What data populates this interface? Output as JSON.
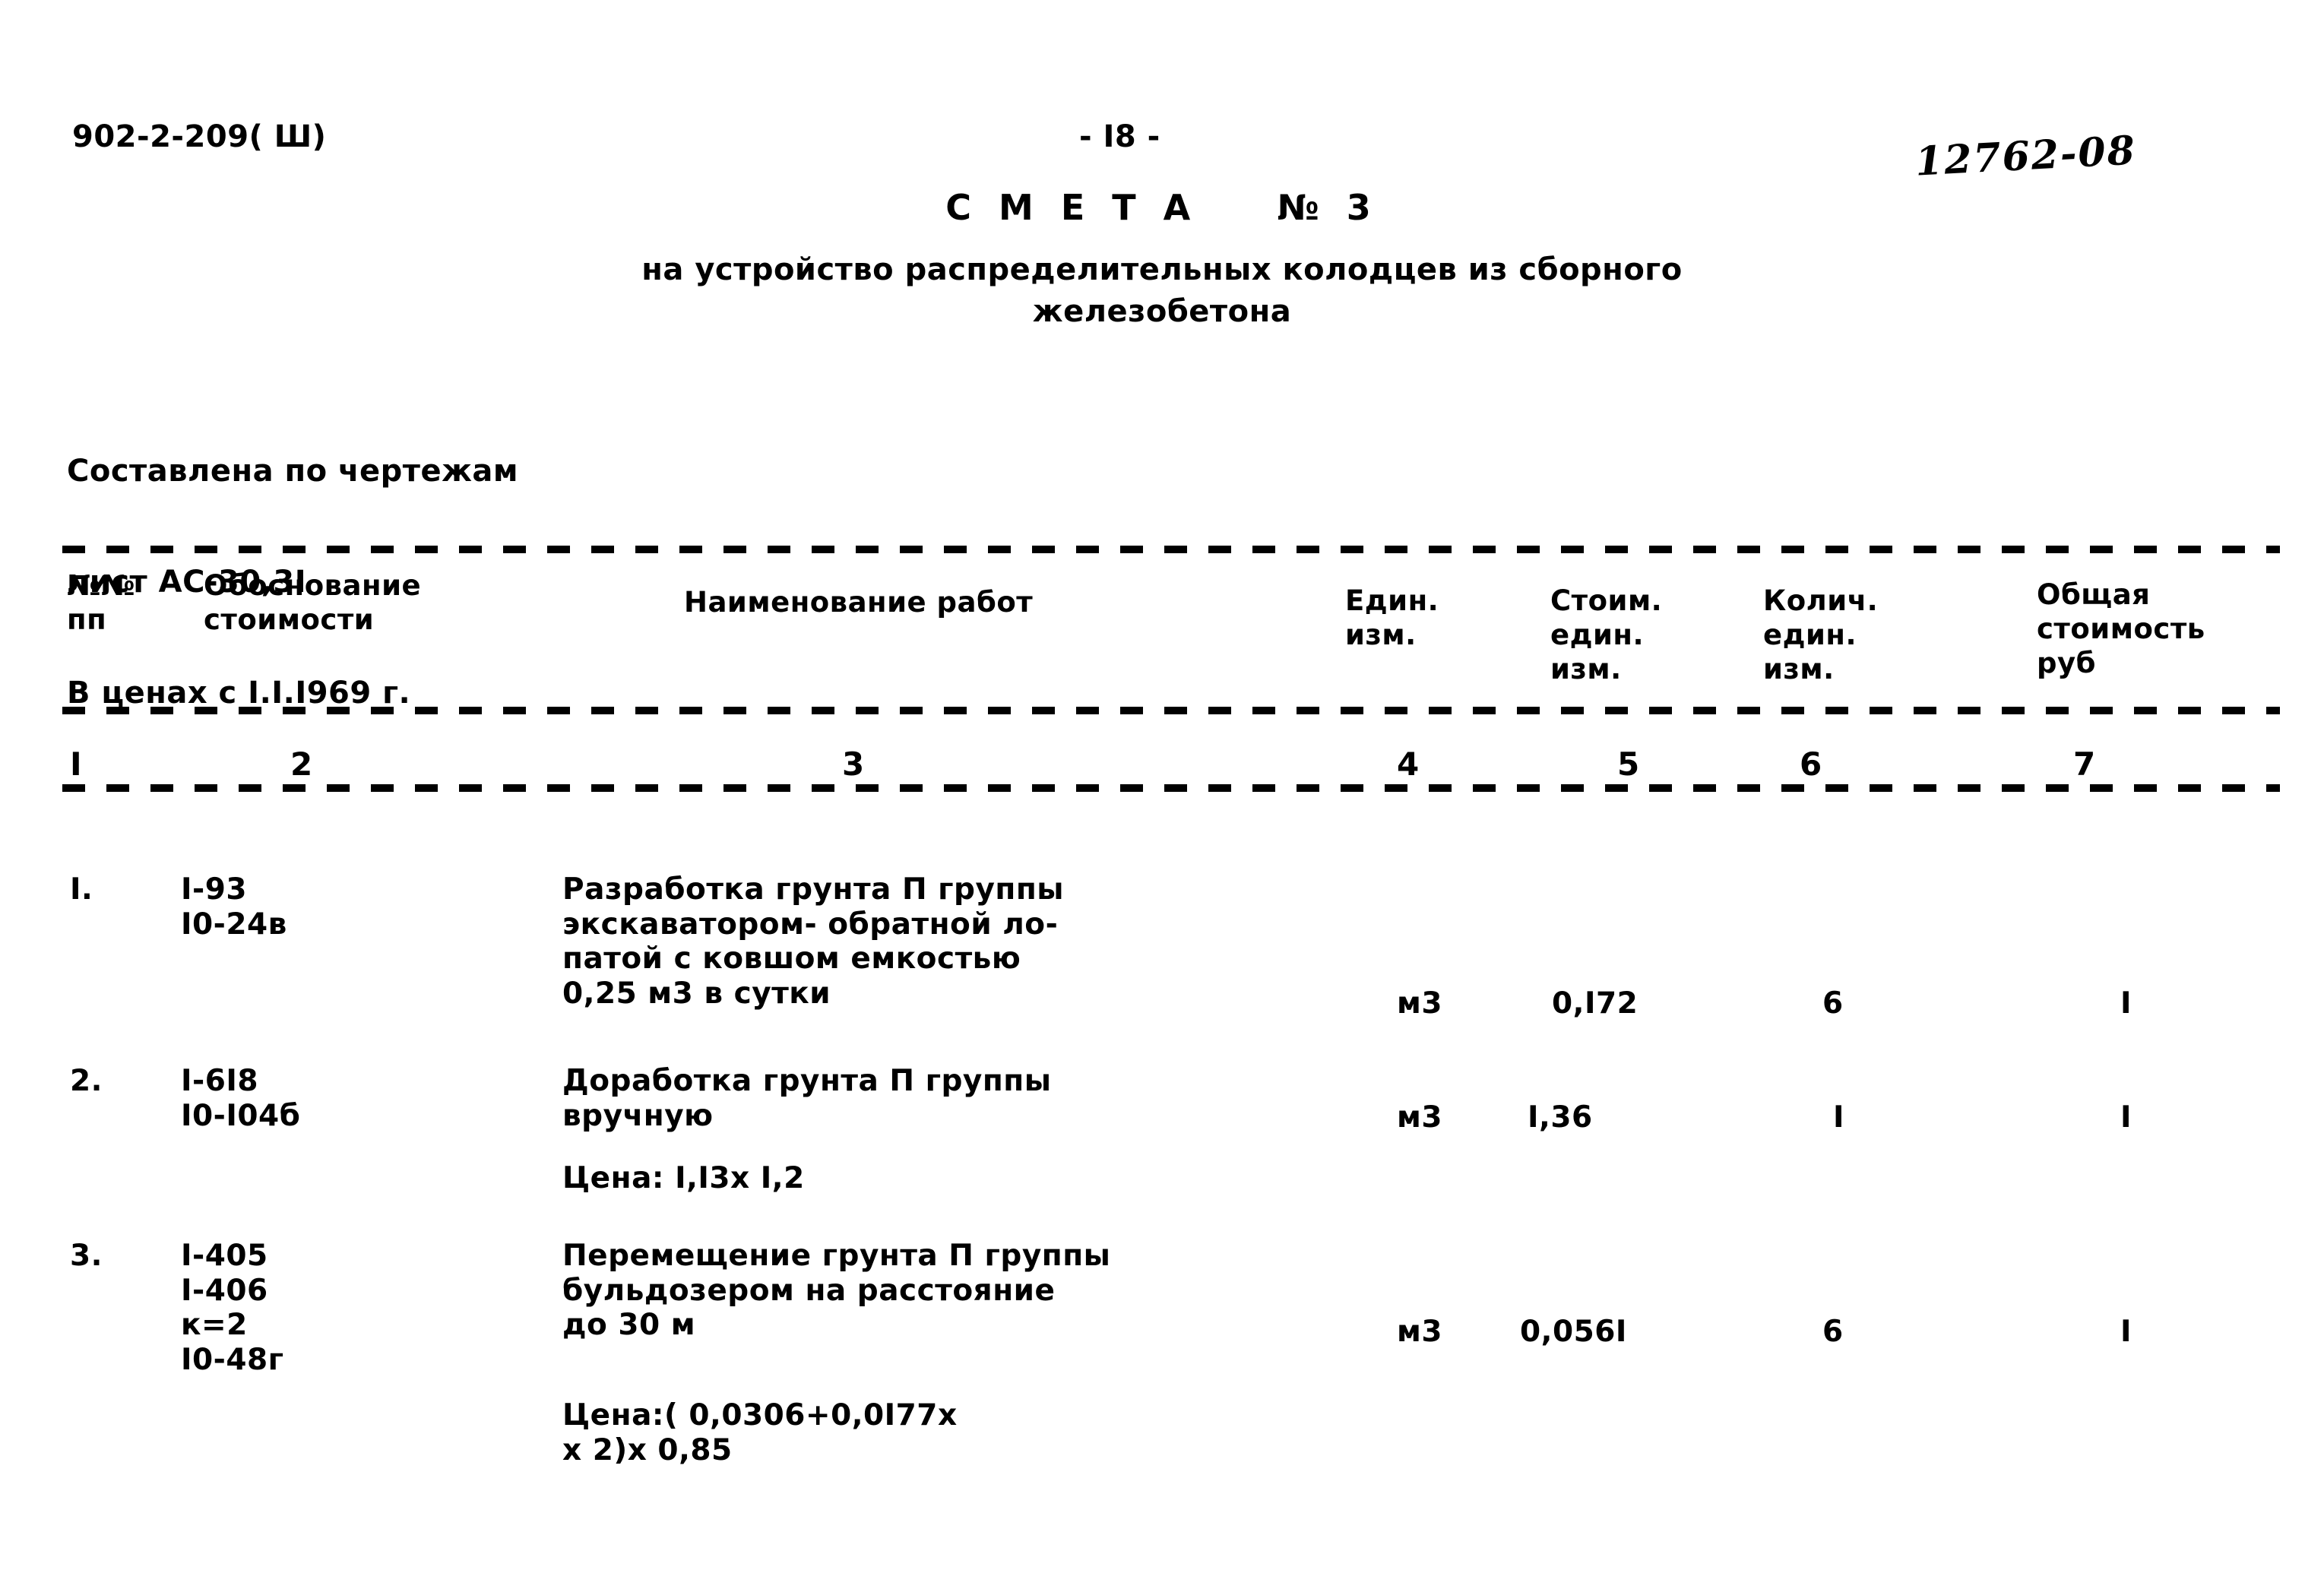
{
  "document": {
    "code": "902-2-209( Ш)",
    "page_number": "- I8 -",
    "handwritten_mark": "12762-08",
    "title": "С М Е Т А    № 3",
    "subtitle_line1": "на устройство распределительных колодцев из сборного",
    "subtitle_line2": "железобетона",
    "preamble": {
      "line1": "Составлена по чертежам",
      "line2": "лист АС-30,3I",
      "line3": "В ценах с I.I.I969 г."
    }
  },
  "table": {
    "headers": {
      "no": "№№\nпп",
      "basis": "Обоснование\nстоимости",
      "name": "Наименование работ",
      "unit": "Един.\nизм.",
      "unit_price": "Стоим.\nедин.\nизм.",
      "quantity": "Колич.\nедин.\nизм.",
      "total": "Общая\nстоимость\nруб"
    },
    "column_numbers": [
      "I",
      "2",
      "3",
      "4",
      "5",
      "6",
      "7"
    ],
    "rows": [
      {
        "no": "I.",
        "basis": "I-93\nI0-24в",
        "description": "Разработка грунта П группы\nэкскаватором- обратной ло-\nпатой с ковшом емкостью\n0,25 м3 в сутки",
        "note": "",
        "unit": "м3",
        "unit_price": "0,I72",
        "quantity": "6",
        "total": "I"
      },
      {
        "no": "2.",
        "basis": "I-6I8\nI0-I04б",
        "description": "Доработка грунта П группы\nвручную",
        "note": "Цена: I,I3х I,2",
        "unit": "м3",
        "unit_price": "I,36",
        "quantity": "I",
        "total": "I"
      },
      {
        "no": "3.",
        "basis": "I-405\nI-406\nк=2\nI0-48г",
        "description": "Перемещение грунта П группы\nбульдозером на расстояние\nдо 30 м",
        "note": "Цена:( 0,0306+0,0I77х\nх 2)х 0,85",
        "unit": "м3",
        "unit_price": "0,056I",
        "quantity": "6",
        "total": "I"
      }
    ]
  }
}
